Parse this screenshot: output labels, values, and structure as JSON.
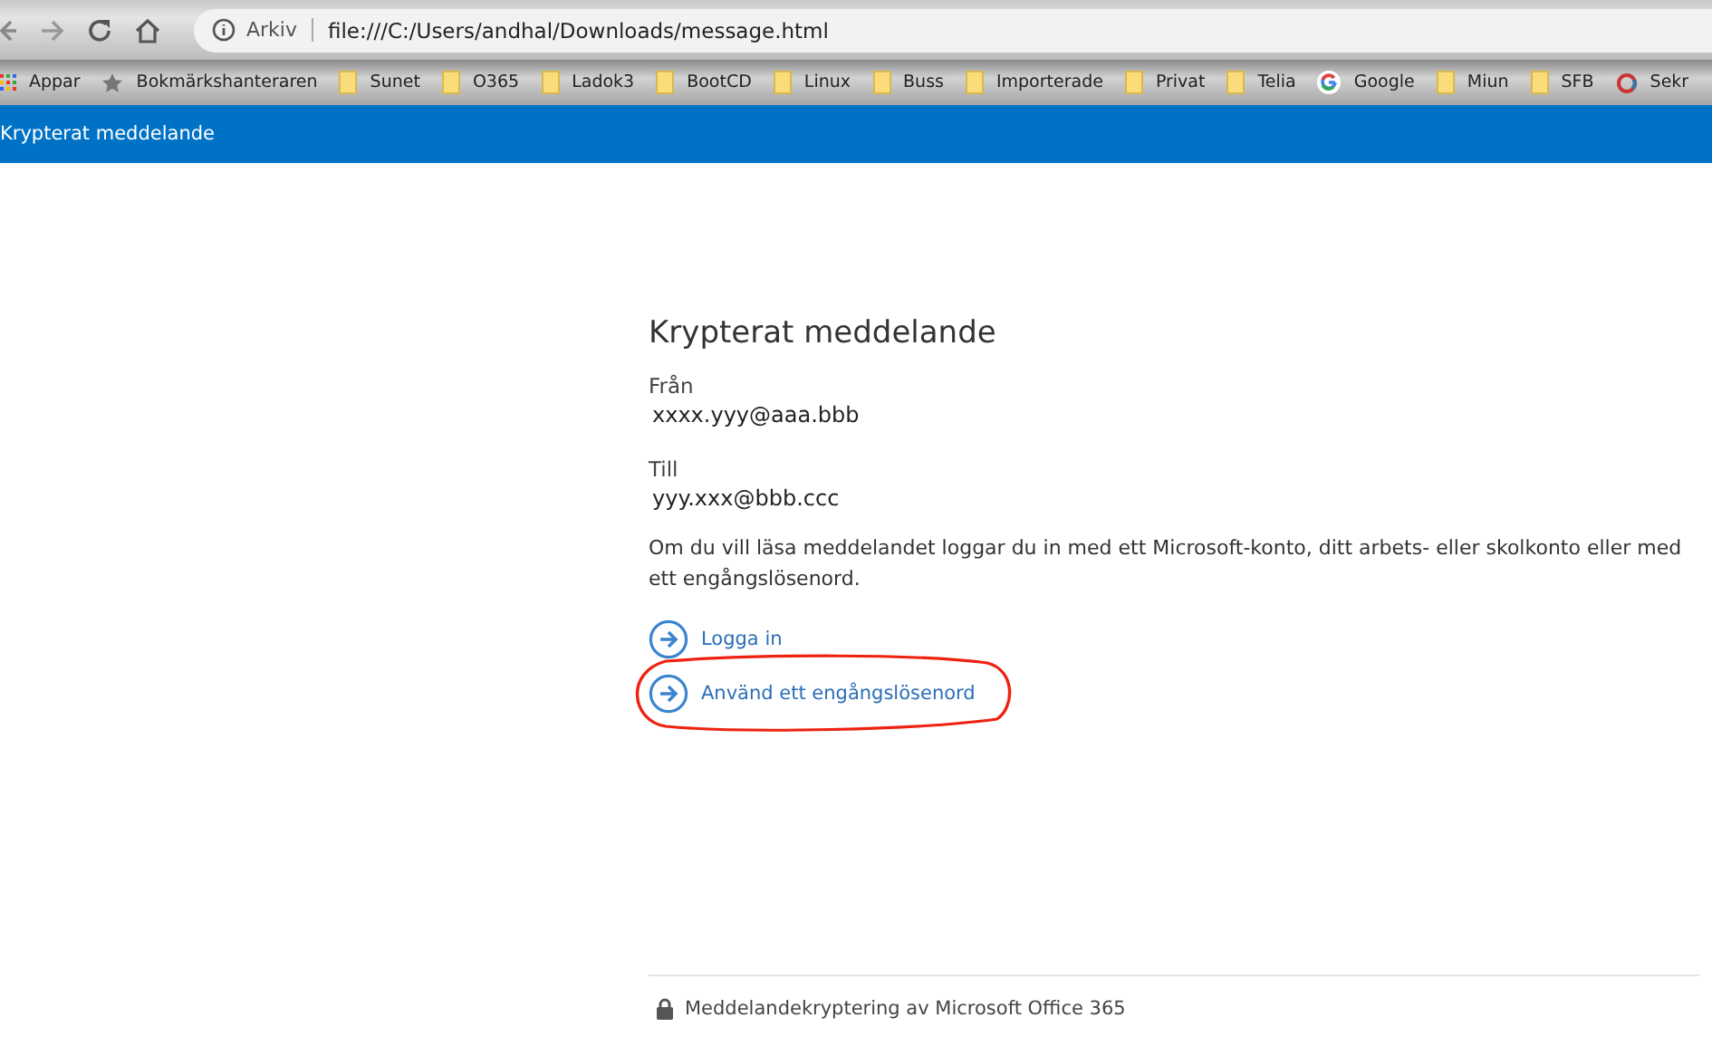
{
  "browser": {
    "address": {
      "security_label": "Arkiv",
      "url": "file:///C:/Users/andhal/Downloads/message.html"
    },
    "bookmarks": [
      {
        "label": "Appar",
        "kind": "apps"
      },
      {
        "label": "Bokmärkshanteraren",
        "kind": "star"
      },
      {
        "label": "Sunet",
        "kind": "folder"
      },
      {
        "label": "O365",
        "kind": "folder"
      },
      {
        "label": "Ladok3",
        "kind": "folder"
      },
      {
        "label": "BootCD",
        "kind": "folder"
      },
      {
        "label": "Linux",
        "kind": "folder"
      },
      {
        "label": "Buss",
        "kind": "folder"
      },
      {
        "label": "Importerade",
        "kind": "folder"
      },
      {
        "label": "Privat",
        "kind": "folder"
      },
      {
        "label": "Telia",
        "kind": "folder"
      },
      {
        "label": "Google",
        "kind": "google"
      },
      {
        "label": "Miun",
        "kind": "folder"
      },
      {
        "label": "SFB",
        "kind": "folder"
      },
      {
        "label": "Sekr",
        "kind": "ring"
      }
    ]
  },
  "header": {
    "title": "Krypterat meddelande"
  },
  "message": {
    "title": "Krypterat meddelande",
    "from_label": "Från",
    "from": "xxxx.yyy@aaa.bbb",
    "to_label": "Till",
    "to": "yyy.xxx@bbb.ccc",
    "body": "Om du vill läsa meddelandet loggar du in med ett Microsoft-konto, ditt arbets- eller skolkonto eller med ett engångslösenord.",
    "actions": [
      {
        "label": "Logga in",
        "circled": false
      },
      {
        "label": "Använd ett engångslösenord",
        "circled": true
      }
    ],
    "footer": "Meddelandekryptering av Microsoft Office 365"
  }
}
